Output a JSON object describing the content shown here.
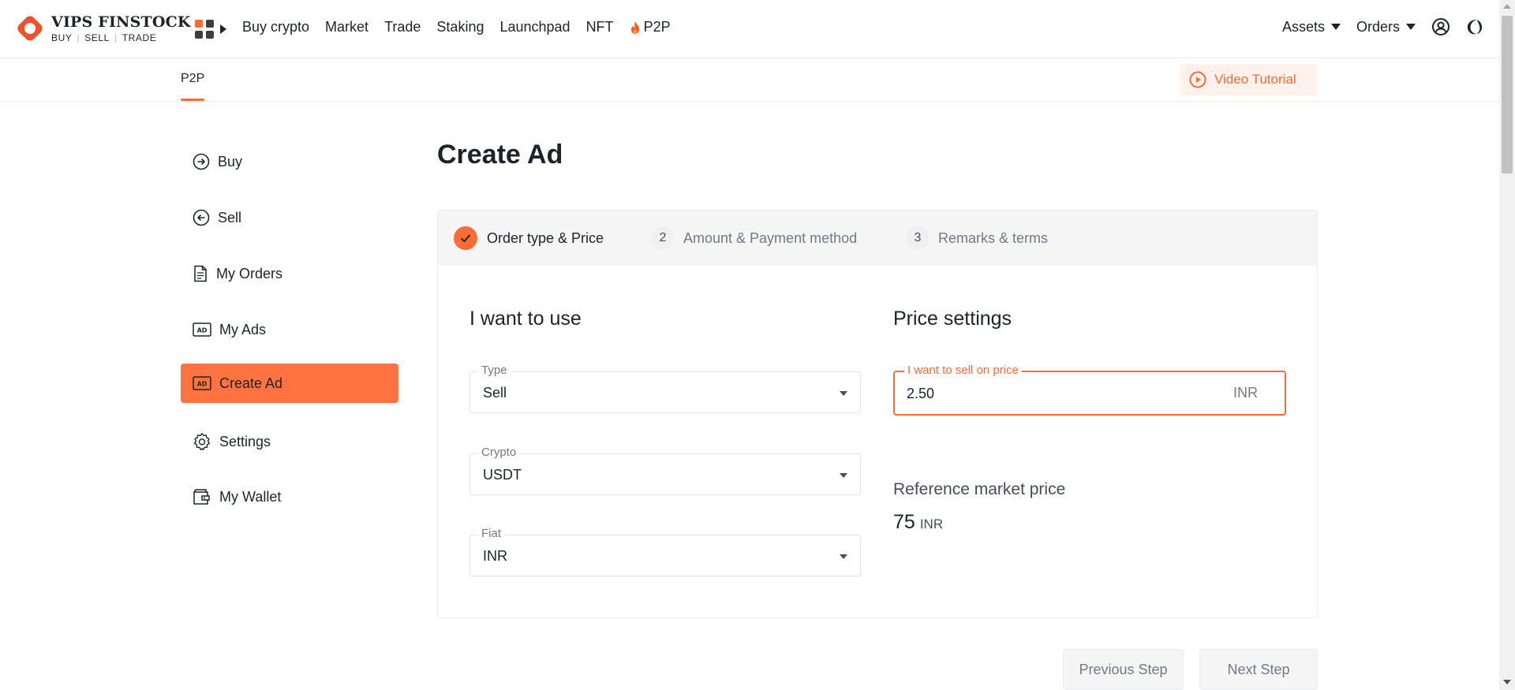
{
  "brand": {
    "name": "VIPS FINSTOCK",
    "tagline": [
      "BUY",
      "SELL",
      "TRADE"
    ],
    "accent_color": "#ff6b35"
  },
  "topnav": {
    "menu": [
      "Buy crypto",
      "Market",
      "Trade",
      "Staking",
      "Launchpad",
      "NFT",
      "P2P"
    ],
    "p2p_icon": "fire-icon",
    "assets_label": "Assets",
    "orders_label": "Orders",
    "icons": [
      "apps-grid-icon",
      "user-icon",
      "moon-icon"
    ]
  },
  "subnav": {
    "tab": "P2P",
    "video_button": "Video Tutorial"
  },
  "sidebar": {
    "items": [
      {
        "label": "Buy",
        "icon": "arrow-right-circle-icon"
      },
      {
        "label": "Sell",
        "icon": "arrow-left-circle-icon"
      },
      {
        "label": "My Orders",
        "icon": "document-icon"
      },
      {
        "label": "My Ads",
        "icon": "ad-icon"
      },
      {
        "label": "Create Ad",
        "icon": "ad-icon",
        "active": true
      },
      {
        "label": "Settings",
        "icon": "gear-icon"
      },
      {
        "label": "My Wallet",
        "icon": "wallet-icon"
      }
    ]
  },
  "main": {
    "title": "Create Ad",
    "steps": [
      {
        "number": "1",
        "label": "Order type & Price",
        "done": true
      },
      {
        "number": "2",
        "label": "Amount & Payment method",
        "done": false
      },
      {
        "number": "3",
        "label": "Remarks & terms",
        "done": false
      }
    ],
    "use_section": {
      "title": "I want to use",
      "fields": [
        {
          "label": "Type",
          "value": "Sell"
        },
        {
          "label": "Crypto",
          "value": "USDT"
        },
        {
          "label": "Fiat",
          "value": "INR"
        }
      ]
    },
    "price_section": {
      "title": "Price settings",
      "price_field": {
        "label": "I want to sell on price",
        "value": "2.50",
        "unit": "INR"
      },
      "reference_label": "Reference market price",
      "reference_value": "75",
      "reference_currency": "INR"
    },
    "buttons": {
      "previous": "Previous Step",
      "next": "Next Step"
    }
  }
}
